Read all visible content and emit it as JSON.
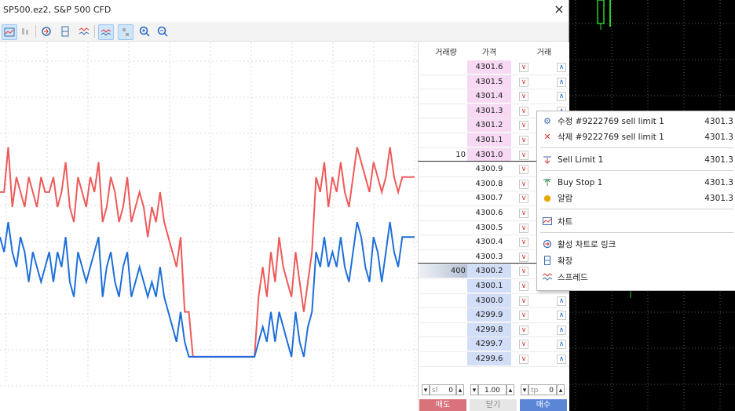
{
  "window": {
    "title": "SP500.ez2, S&P 500 CFD",
    "close": "×"
  },
  "toolbar": {
    "icons": [
      "chart-icon",
      "depth-icon",
      "link-icon",
      "expand-icon",
      "spread-icon",
      "auto-scroll-icon",
      "order-icon",
      "zoom-in-icon",
      "zoom-out-icon"
    ]
  },
  "dom": {
    "headers": {
      "volume": "거래량",
      "price": "가격",
      "trade": "거래"
    },
    "ask_rows": [
      {
        "price": "4301.6",
        "vol": ""
      },
      {
        "price": "4301.5",
        "vol": ""
      },
      {
        "price": "4301.4",
        "vol": ""
      },
      {
        "price": "4301.3",
        "vol": ""
      },
      {
        "price": "4301.2",
        "vol": ""
      },
      {
        "price": "4301.1",
        "vol": ""
      },
      {
        "price": "4301.0",
        "vol": "10"
      }
    ],
    "mid_rows": [
      {
        "price": "4300.9",
        "vol": ""
      },
      {
        "price": "4300.8",
        "vol": ""
      },
      {
        "price": "4300.7",
        "vol": ""
      },
      {
        "price": "4300.6",
        "vol": ""
      },
      {
        "price": "4300.5",
        "vol": ""
      },
      {
        "price": "4300.4",
        "vol": ""
      },
      {
        "price": "4300.3",
        "vol": ""
      }
    ],
    "bid_rows": [
      {
        "price": "4300.2",
        "vol": "400"
      },
      {
        "price": "4300.1",
        "vol": ""
      },
      {
        "price": "4300.0",
        "vol": ""
      },
      {
        "price": "4299.9",
        "vol": ""
      },
      {
        "price": "4299.8",
        "vol": ""
      },
      {
        "price": "4299.7",
        "vol": ""
      },
      {
        "price": "4299.6",
        "vol": ""
      }
    ],
    "controls": {
      "sl_label": "sl",
      "sl_value": "0",
      "volume": "1.00",
      "tp_label": "tp",
      "tp_value": "0"
    },
    "buttons": {
      "sell": "매도",
      "close": "닫기",
      "buy": "매수"
    },
    "colors": {
      "ask": "#f7d9f3",
      "bid": "#d2ddf7",
      "sell_btn": "#d9727a",
      "buy_btn": "#5b86d6"
    }
  },
  "chart_data": {
    "type": "line",
    "series": [
      {
        "color": "#ee5a5a",
        "values": [
          4300.7,
          4300.7,
          4301.0,
          4300.6,
          4300.8,
          4300.7,
          4300.6,
          4300.8,
          4300.7,
          4300.6,
          4300.8,
          4300.7,
          4300.7,
          4300.8,
          4300.6,
          4300.7,
          4300.9,
          4300.6,
          4300.5,
          4300.8,
          4300.7,
          4300.6,
          4300.8,
          4300.7,
          4300.9,
          4300.5,
          4300.6,
          4300.8,
          4300.7,
          4300.5,
          4300.6,
          4300.8,
          4300.5,
          4300.6,
          4300.7,
          4300.6,
          4300.4,
          4300.6,
          4300.5,
          4300.7,
          4300.5,
          4300.4,
          4300.3,
          4300.2,
          4300.4,
          4299.9,
          4299.9,
          4299.6,
          4299.6,
          4299.6,
          4299.6,
          4299.6,
          4299.6,
          4299.6,
          4299.6,
          4299.6,
          4299.6,
          4299.6,
          4299.6,
          4299.6,
          4299.6,
          4299.6,
          4299.6,
          4300.0,
          4300.2,
          4300.0,
          4300.3,
          4300.1,
          4300.4,
          4300.2,
          4300.1,
          4300.0,
          4300.3,
          4300.1,
          4299.9,
          4300.1,
          4300.3,
          4300.8,
          4300.7,
          4300.9,
          4300.6,
          4300.8,
          4300.7,
          4300.9,
          4300.7,
          4300.6,
          4300.8,
          4301.0,
          4300.9,
          4300.8,
          4300.7,
          4300.9,
          4300.8,
          4300.7,
          4300.8,
          4301.0,
          4300.8,
          4300.7,
          4300.8,
          4300.8,
          4300.8,
          4300.8
        ]
      },
      {
        "color": "#1e6fd9",
        "values": [
          4300.4,
          4300.3,
          4300.5,
          4300.3,
          4300.2,
          4300.4,
          4300.3,
          4300.1,
          4300.3,
          4300.2,
          4300.1,
          4300.2,
          4300.3,
          4300.1,
          4300.3,
          4300.2,
          4300.4,
          4300.1,
          4300.0,
          4300.3,
          4300.2,
          4300.1,
          4300.2,
          4300.3,
          4300.4,
          4300.0,
          4300.2,
          4300.3,
          4300.1,
          4300.0,
          4300.2,
          4300.3,
          4300.0,
          4300.1,
          4300.2,
          4300.1,
          4300.0,
          4300.1,
          4300.0,
          4300.2,
          4300.0,
          4299.9,
          4299.8,
          4299.7,
          4299.9,
          4299.7,
          4299.6,
          4299.6,
          4299.6,
          4299.6,
          4299.6,
          4299.6,
          4299.6,
          4299.6,
          4299.6,
          4299.6,
          4299.6,
          4299.6,
          4299.6,
          4299.6,
          4299.6,
          4299.6,
          4299.6,
          4299.7,
          4299.8,
          4299.7,
          4299.9,
          4299.7,
          4299.9,
          4299.8,
          4299.7,
          4299.6,
          4299.9,
          4299.7,
          4299.6,
          4299.8,
          4299.9,
          4300.3,
          4300.2,
          4300.4,
          4300.2,
          4300.3,
          4300.2,
          4300.4,
          4300.2,
          4300.1,
          4300.3,
          4300.5,
          4300.4,
          4300.2,
          4300.1,
          4300.4,
          4300.3,
          4300.1,
          4300.3,
          4300.5,
          4300.3,
          4300.2,
          4300.4,
          4300.4,
          4300.4,
          4300.4
        ]
      }
    ],
    "ylim": [
      4299.5,
      4301.7
    ],
    "grid": true
  },
  "context_menu": {
    "items": [
      {
        "icon": "gear-icon",
        "label": "수정 #9222769 sell limit 1",
        "price": "4301.3"
      },
      {
        "icon": "delete-icon",
        "label": "삭제 #9222769 sell limit 1",
        "price": "4301.3"
      },
      {
        "icon": "sell-limit-icon",
        "label": "Sell Limit 1",
        "price": "4301.3"
      },
      {
        "icon": "buy-stop-icon",
        "label": "Buy Stop 1",
        "price": "4301.3"
      },
      {
        "icon": "bell-icon",
        "label": "알람",
        "price": "4301.3"
      },
      {
        "icon": "chart-icon",
        "label": "차트",
        "price": ""
      },
      {
        "icon": "link-icon",
        "label": "활성 차트로 링크",
        "price": ""
      },
      {
        "icon": "expand-icon",
        "label": "확장",
        "price": ""
      },
      {
        "icon": "spread-icon",
        "label": "스프레드",
        "price": ""
      }
    ]
  }
}
